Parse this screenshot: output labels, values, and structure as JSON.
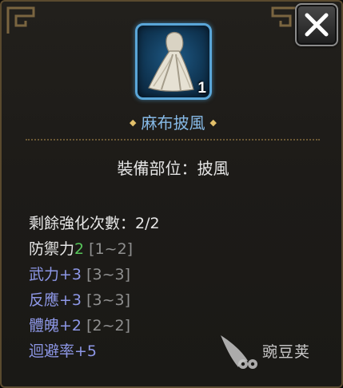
{
  "item": {
    "name": "麻布披風",
    "count": "1",
    "icon": "cloak-icon"
  },
  "equip_slot_line": "裝備部位：披風",
  "stats": {
    "upgrade_remaining": "剩餘強化次數：2/2",
    "defense": {
      "label": "防禦力",
      "value": "2",
      "range": "[1~2]"
    },
    "force": {
      "label": "武力+3",
      "range": "[3~3]"
    },
    "reaction": {
      "label": "反應+3",
      "range": "[3~3]"
    },
    "physique": {
      "label": "體魄+2",
      "range": "[2~2]"
    },
    "evasion": {
      "label": "迴避率+5"
    }
  },
  "watermark": {
    "text": "豌豆荚"
  },
  "colors": {
    "name": "#86b9e6",
    "base_stat": "#e6e6e6",
    "defense_value": "#57c55a",
    "bonus_stat": "#8d97e6",
    "range": "#8f8f8f",
    "frame": "#5a4a2e"
  }
}
